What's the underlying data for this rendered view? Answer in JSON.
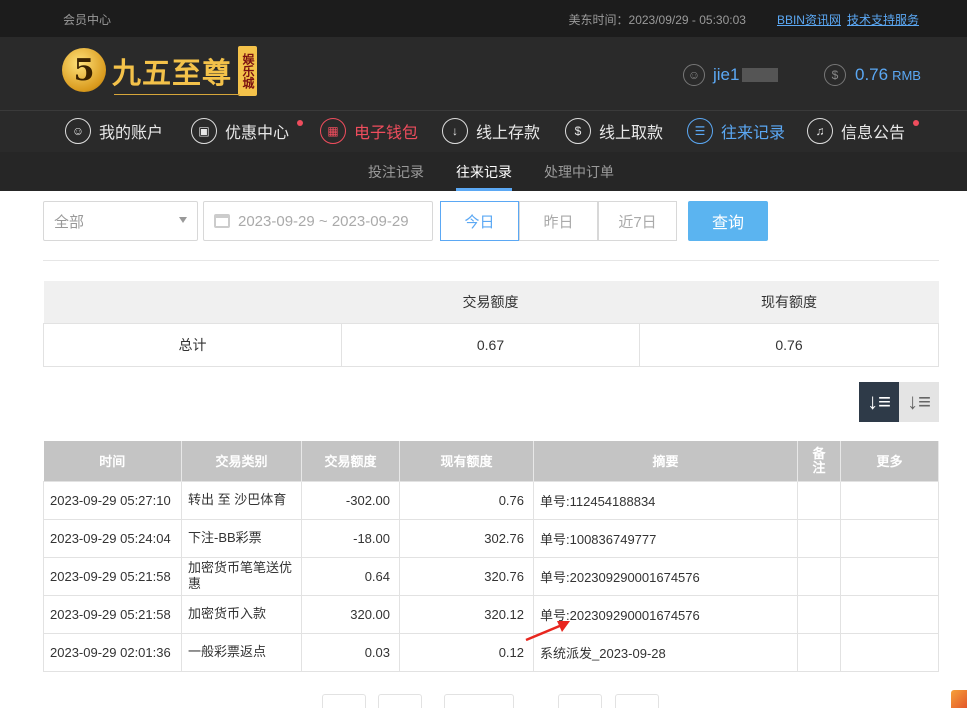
{
  "topbar": {
    "left": "会员中心",
    "time": "美东时间：2023/09/29 - 05:30:03",
    "link1": "BBIN资讯网",
    "link2": "技术支持服务"
  },
  "logo": {
    "mark": "5",
    "text": "九五至尊",
    "badge": "娱乐城"
  },
  "user": {
    "name": "jie1"
  },
  "balance": {
    "amount": "0.76",
    "unit": "RMB"
  },
  "nav": [
    {
      "label": "我的账户",
      "icon": "user-icon"
    },
    {
      "label": "优惠中心",
      "icon": "gift-icon"
    },
    {
      "label": "电子钱包",
      "icon": "wallet-icon"
    },
    {
      "label": "线上存款",
      "icon": "deposit-icon"
    },
    {
      "label": "线上取款",
      "icon": "withdraw-icon"
    },
    {
      "label": "往来记录",
      "icon": "record-icon"
    },
    {
      "label": "信息公告",
      "icon": "bell-icon"
    }
  ],
  "subnav": [
    "投注记录",
    "往来记录",
    "处理中订单"
  ],
  "filter": {
    "select": "全部",
    "date": "2023-09-29 ~ 2023-09-29",
    "seg": [
      "今日",
      "昨日",
      "近7日"
    ],
    "query": "查询"
  },
  "summary": {
    "headers": [
      "",
      "交易额度",
      "现有额度"
    ],
    "row": [
      "总计",
      "0.67",
      "0.76"
    ]
  },
  "records": {
    "headers": [
      "时间",
      "交易类别",
      "交易额度",
      "现有额度",
      "摘要",
      "备注",
      "更多"
    ],
    "rows": [
      [
        "2023-09-29 05:27:10",
        "转出 至 沙巴体育",
        "-302.00",
        "0.76",
        "单号:112454188834",
        "",
        ""
      ],
      [
        "2023-09-29 05:24:04",
        "下注-BB彩票",
        "-18.00",
        "302.76",
        "单号:100836749777",
        "",
        ""
      ],
      [
        "2023-09-29 05:21:58",
        "加密货币笔笔送优惠",
        "0.64",
        "320.76",
        "单号:202309290001674576",
        "",
        ""
      ],
      [
        "2023-09-29 05:21:58",
        "加密货币入款",
        "320.00",
        "320.12",
        "单号:202309290001674576",
        "",
        ""
      ],
      [
        "2023-09-29 02:01:36",
        "一般彩票返点",
        "0.03",
        "0.12",
        "系统派发_2023-09-28",
        "",
        ""
      ]
    ]
  }
}
